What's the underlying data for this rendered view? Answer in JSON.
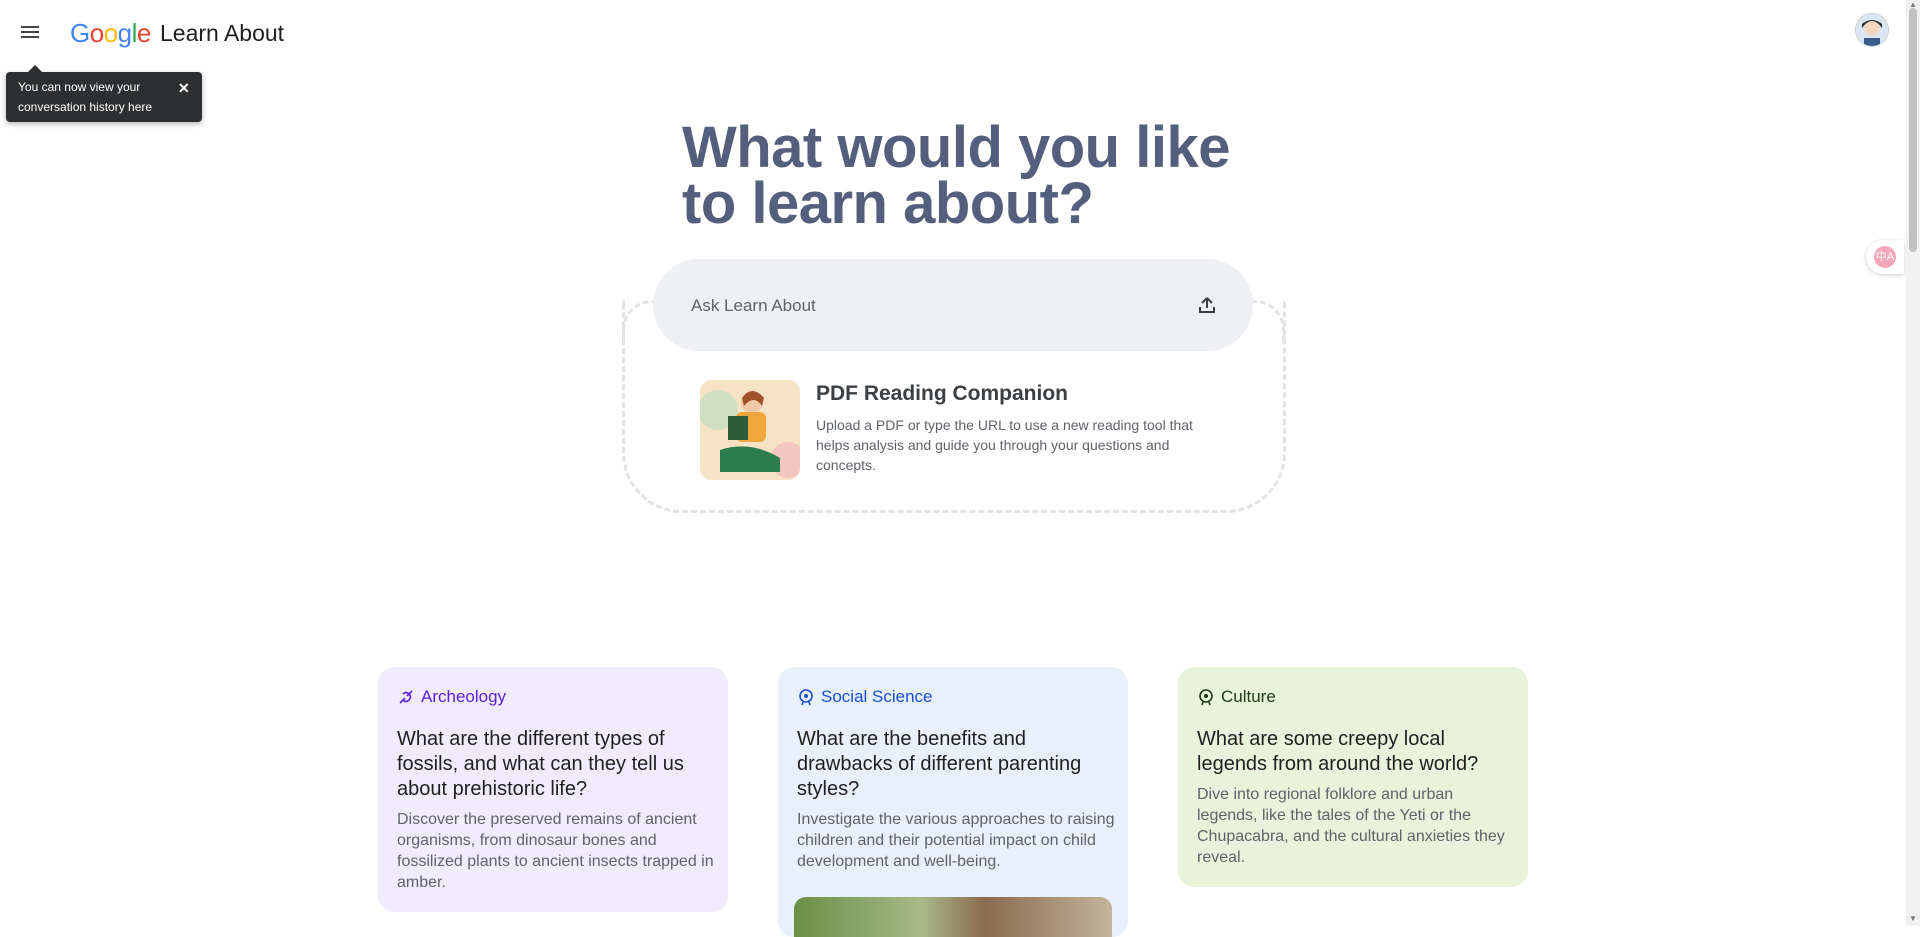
{
  "header": {
    "logo_text": "Google",
    "app_name": "Learn About"
  },
  "tooltip": {
    "text": "You can now view your conversation history here",
    "close": "✕"
  },
  "hero": {
    "title": "What would you like to learn about?"
  },
  "search": {
    "placeholder": "Ask Learn About"
  },
  "pdf_companion": {
    "title": "PDF Reading Companion",
    "description": "Upload a PDF or type the URL to use a new reading tool that helps analysis and guide you through your questions and concepts."
  },
  "cards": [
    {
      "category": "Archeology",
      "question": "What are the different types of fossils, and what can they tell us about prehistoric life?",
      "description": "Discover the preserved remains of ancient organisms, from dinosaur bones and fossilized plants to ancient insects trapped in amber."
    },
    {
      "category": "Social Science",
      "question": "What are the benefits and drawbacks of different parenting styles?",
      "description": "Investigate the various approaches to raising children and their potential impact on child development and well-being."
    },
    {
      "category": "Culture",
      "question": "What are some creepy local legends from around the world?",
      "description": "Dive into regional folklore and urban legends, like the tales of the Yeti or the Chupacabra, and the cultural anxieties they reveal."
    }
  ],
  "translate": {
    "label": "中A"
  },
  "colors": {
    "hero": "#545e7d",
    "archeology_bg": "#f1ecfd",
    "social_bg": "#e8f0fb",
    "culture_bg": "#e8f3dc"
  }
}
